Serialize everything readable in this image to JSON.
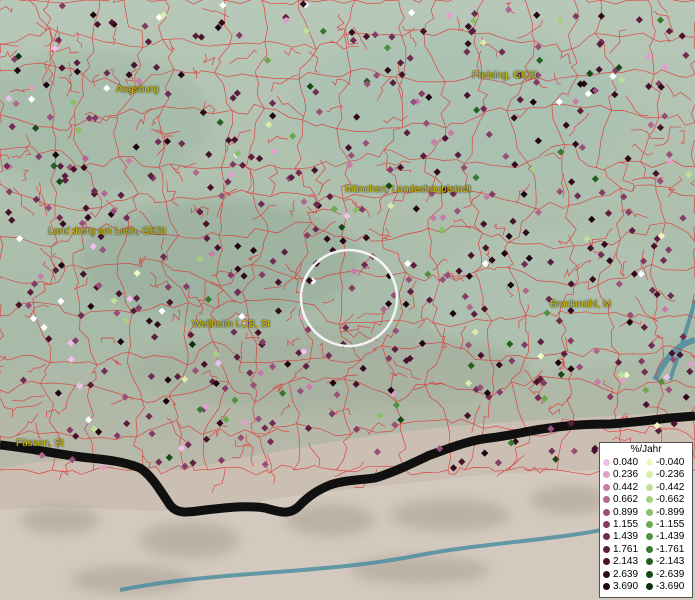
{
  "map": {
    "legend": {
      "title": "%/Jahr",
      "positive": [
        {
          "label": "0.040",
          "color": "#f0c0ec"
        },
        {
          "label": "0.236",
          "color": "#e0a0cc"
        },
        {
          "label": "0.442",
          "color": "#c87ca8"
        },
        {
          "label": "0.662",
          "color": "#b06890"
        },
        {
          "label": "0.899",
          "color": "#98507a"
        },
        {
          "label": "1.155",
          "color": "#843c66"
        },
        {
          "label": "1.439",
          "color": "#702c52"
        },
        {
          "label": "1.761",
          "color": "#5c1e3e"
        },
        {
          "label": "2.143",
          "color": "#48122c"
        },
        {
          "label": "2.639",
          "color": "#320a1c"
        },
        {
          "label": "3.690",
          "color": "#1e0410"
        }
      ],
      "negative": [
        {
          "label": "-0.040",
          "color": "#f0f8c0"
        },
        {
          "label": "-0.236",
          "color": "#d8ecac"
        },
        {
          "label": "-0.442",
          "color": "#c0e098"
        },
        {
          "label": "-0.662",
          "color": "#a4d080"
        },
        {
          "label": "-0.899",
          "color": "#88c068"
        },
        {
          "label": "-1.155",
          "color": "#6ca850"
        },
        {
          "label": "-1.439",
          "color": "#509040"
        },
        {
          "label": "-1.761",
          "color": "#387830"
        },
        {
          "label": "-2.143",
          "color": "#246020"
        },
        {
          "label": "-2.639",
          "color": "#164a14"
        },
        {
          "label": "-3.690",
          "color": "#0a320a"
        }
      ]
    },
    "cities": [
      {
        "name": "Augsburg"
      },
      {
        "name": "Freising, GKSt"
      },
      {
        "name": "München, Landeshauptstadt"
      },
      {
        "name": "Landsberg am Lech, GKSt"
      },
      {
        "name": "Weilheim i.OB, St"
      },
      {
        "name": "Bruckmühl, M"
      },
      {
        "name": "Füssen, St"
      }
    ]
  }
}
